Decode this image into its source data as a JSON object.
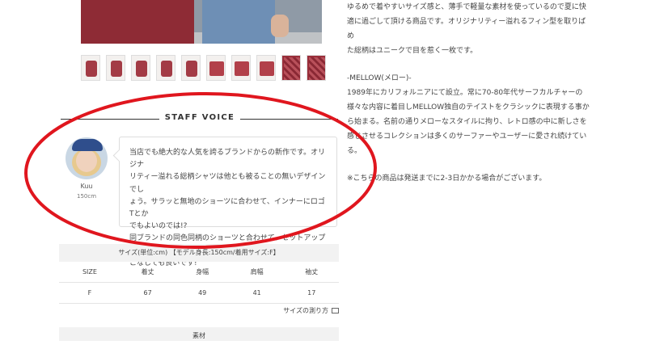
{
  "description_lines": [
    "ゆるめで着やすいサイズ感と、薄手で軽量な素材を使っているので夏に快",
    "適に過ごして頂ける商品です。オリジナリティー溢れるフィン型を取りばめ",
    "た総柄はユニークで目を惹く一枚です。"
  ],
  "brand": {
    "heading": "-MELLOW(メロー)-",
    "lines": [
      "1989年にカリフォルニアにて設立。常に70-80年代サーフカルチャーの",
      "様々な内容に着目しMELLOW独自のテイストをクラシックに表現する事か",
      "ら始まる。名前の通りメローなスタイルに拘り、レトロ感の中に新しさを",
      "感じさせるコレクションは多くのサーファーやユーザーに愛され続けてい",
      "る。"
    ]
  },
  "shipping_note": "※こちらの商品は発送までに2-3日かかる場合がございます。",
  "staff_voice": {
    "title": "STAFF VOICE",
    "name": "Kuu",
    "height": "150cm",
    "comment_lines": [
      "当店でも絶大的な人気を誇るブランドからの新作です。オリジナ",
      "リティー溢れる総柄シャツは他とも被ることの無いデザインでし",
      "ょう。サラッと無地のショーツに合わせて、インナーにロゴTとか",
      "でもよいのでは!?",
      "同ブランドの同色同柄のショーツと合わせて、セットアップで着",
      "こなしても良いです!"
    ]
  },
  "size_chart": {
    "heading": "サイズ(単位:cm) 【モデル身長:150cm/着用サイズ:F】",
    "headers": [
      "SIZE",
      "着丈",
      "身幅",
      "肩幅",
      "袖丈"
    ],
    "rows": [
      [
        "F",
        "67",
        "49",
        "41",
        "17"
      ]
    ],
    "measure_link": "サイズの測り方"
  },
  "material_label": "素材",
  "annotation_color": "#e0161e"
}
